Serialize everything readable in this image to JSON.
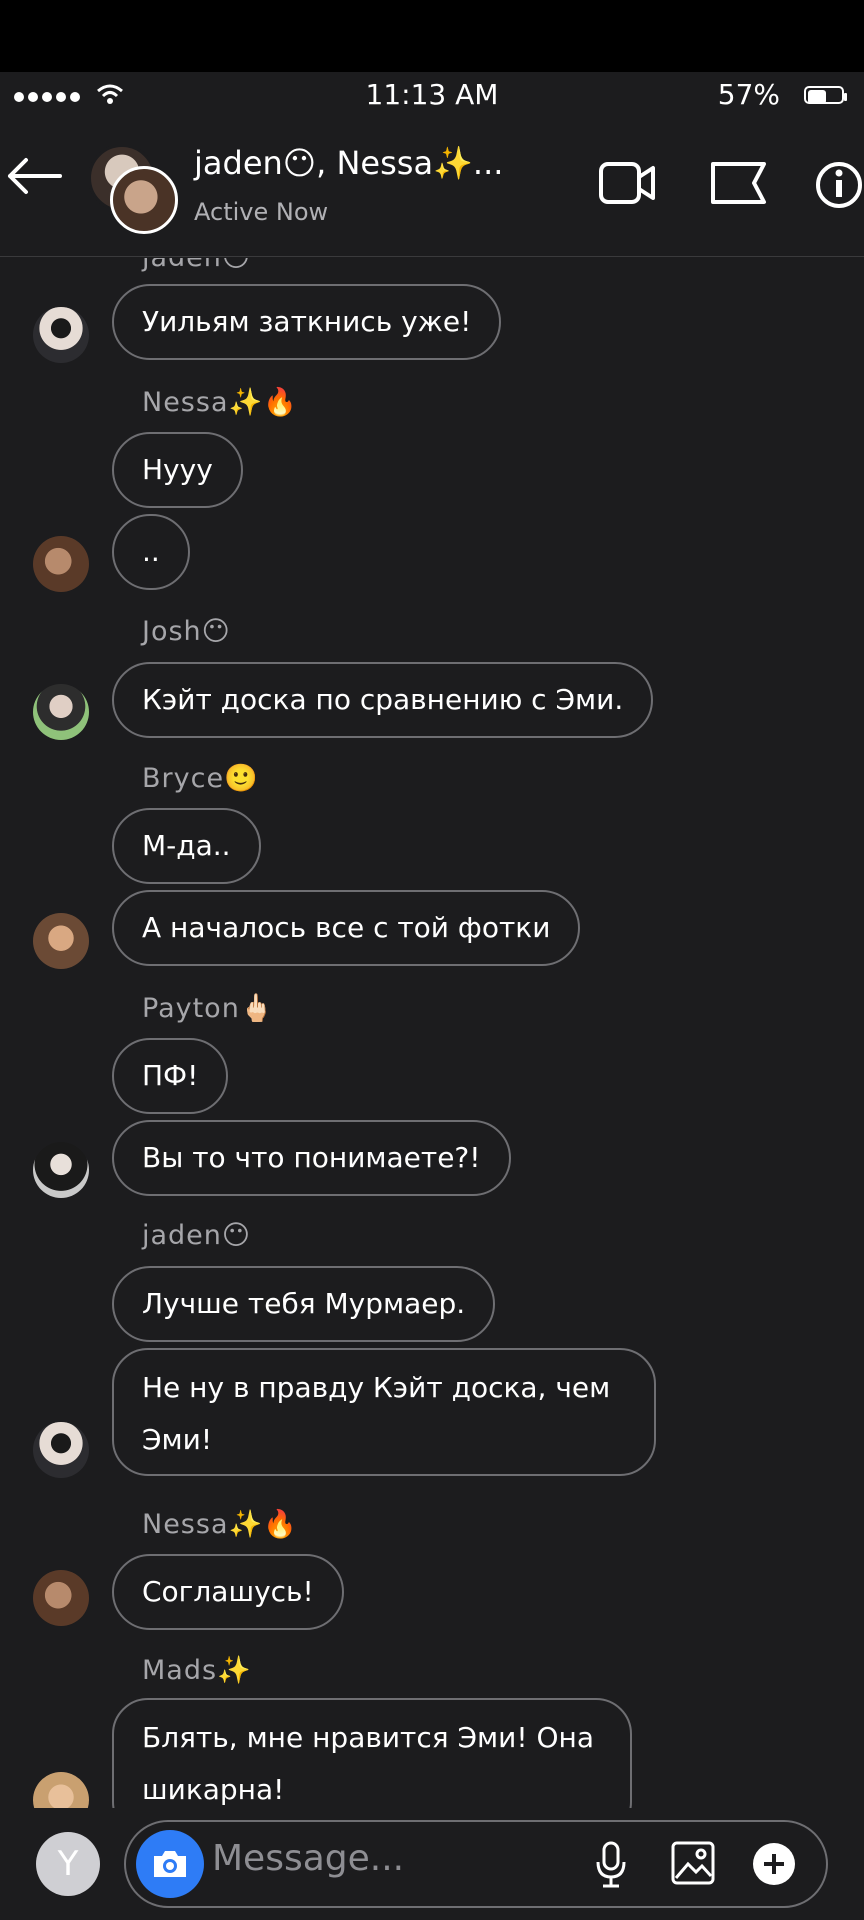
{
  "status_bar": {
    "time": "11:13 AM",
    "battery": "57%",
    "battery_level": 0.57
  },
  "header": {
    "title": "jaden😶, Nessa✨...",
    "subtitle": "Active Now"
  },
  "messages": [
    {
      "sender": "jaden😶",
      "text": "Уильям заткнись уже!"
    },
    {
      "sender": "Nessa✨🔥",
      "text": "Нууу"
    },
    {
      "text": ".."
    },
    {
      "sender": "Josh😶",
      "text": "Кэйт доска по сравнению с Эми."
    },
    {
      "sender": "Bryce🙂",
      "text": "М-да.."
    },
    {
      "text": "А началось все с той фотки"
    },
    {
      "sender": "Payton🖕🏻",
      "text": "ПФ!"
    },
    {
      "text": "Вы то что понимаете?!"
    },
    {
      "sender": "jaden😶",
      "text": "Лучше тебя Мурмаер."
    },
    {
      "text": "Не ну в правду Кэйт доска, чем Эми!"
    },
    {
      "sender": "Nessa✨🔥",
      "text": "Соглашусь!"
    },
    {
      "sender": "Mads✨",
      "text": "Блять, мне нравится Эми! Она шикарна!"
    }
  ],
  "composer": {
    "avatar_letter": "Y",
    "placeholder": "Message..."
  },
  "icons": [
    "back-arrow-icon",
    "video-call-icon",
    "flag-icon",
    "info-icon",
    "camera-icon",
    "microphone-icon",
    "gallery-icon",
    "plus-icon"
  ]
}
